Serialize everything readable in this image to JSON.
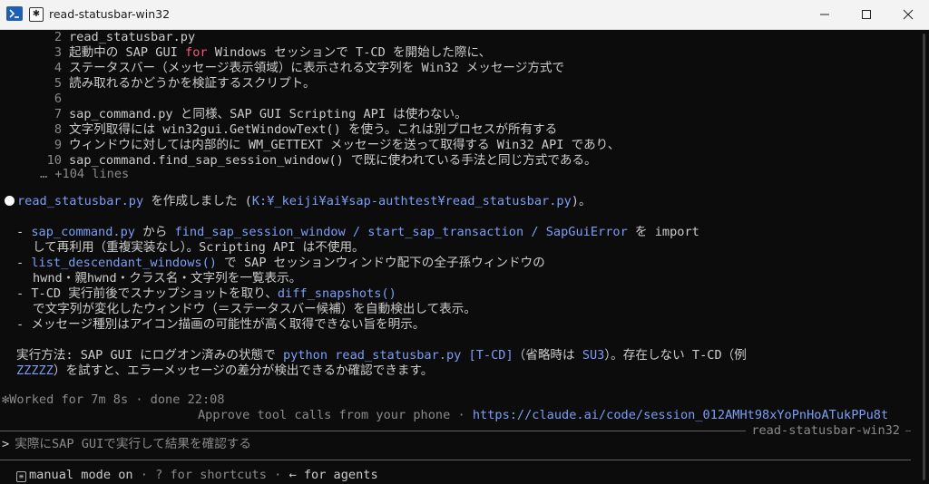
{
  "window": {
    "title": "read-statusbar-win32",
    "icon": "terminal-icon",
    "tab_icon": "asterisk-icon",
    "tab_icon_glyph": "✱"
  },
  "code_lines": [
    {
      "num": "2",
      "text": "read_statusbar.py"
    },
    {
      "num": "3",
      "pre": "起動中の SAP GUI ",
      "kw": "for",
      "post": " Windows セッションで T-CD を開始した際に、"
    },
    {
      "num": "4",
      "text": "ステータスバー（メッセージ表示領域）に表示される文字列を Win32 メッセージ方式で"
    },
    {
      "num": "5",
      "text": "読み取れるかどうかを検証するスクリプト。"
    },
    {
      "num": "6",
      "text": ""
    },
    {
      "num": "7",
      "text": "sap_command.py と同様、SAP GUI Scripting API は使わない。"
    },
    {
      "num": "8",
      "text": "文字列取得には win32gui.GetWindowText() を使う。これは別プロセスが所有する"
    },
    {
      "num": "9",
      "text": "ウィンドウに対しては内部的に WM_GETTEXT メッセージを送って取得する Win32 API であり、"
    },
    {
      "num": "10",
      "text": "sap_command.find_sap_session_window() で既に使われている手法と同じ方式である。"
    }
  ],
  "more_lines": "… +104 lines",
  "result": {
    "file": "read_statusbar.py",
    "mid": " を作成しました (",
    "path": "K:¥_keiji¥ai¥sap-authtest¥read_statusbar.py",
    "end": ")。"
  },
  "bullets": {
    "b1": {
      "a": "sap_command.py",
      "b": " から ",
      "c": "find_sap_session_window / start_sap_transaction / SapGuiError",
      "d": " を import",
      "cont": "して再利用（重複実装なし）。Scripting API は不使用。"
    },
    "b2": {
      "a": "list_descendant_windows()",
      "b": " で SAP セッションウィンドウ配下の全子孫ウィンドウの",
      "cont": "hwnd・親hwnd・クラス名・文字列を一覧表示。"
    },
    "b3": {
      "a": "T-CD 実行前後でスナップショットを取り、",
      "b": "diff_snapshots()",
      "cont": "で文字列が変化したウィンドウ（＝ステータスバー候補）を自動検出して表示。"
    },
    "b4": {
      "a": "メッセージ種別はアイコン描画の可能性が高く取得できない旨を明示。"
    }
  },
  "usage": {
    "a": "実行方法: SAP GUI にログオン済みの状態で ",
    "b": "python read_statusbar.py [T-CD]",
    "c": "（省略時は ",
    "d": "SU3",
    "e": "）。存在しない T-CD（例",
    "f": "ZZZZZ",
    "g": "）を試すと、エラーメッセージの差分が検出できるか確認できます。"
  },
  "worked": "✻Worked for 7m 8s · done 22:08",
  "approve": {
    "text": "Approve tool calls from your phone · ",
    "link": "https://claude.ai/code/session_012AMHt98xYoPnHoATukPPu8t"
  },
  "session_label": "read-statusbar-win32",
  "prompt": {
    "symbol": ">",
    "placeholder": "実際にSAP GUIで実行して結果を確認する"
  },
  "footer": {
    "mode_icon_glyph": "≡",
    "mode": "manual mode on",
    "shortcuts": " · ? for shortcuts · ",
    "agents": "← for agents"
  }
}
